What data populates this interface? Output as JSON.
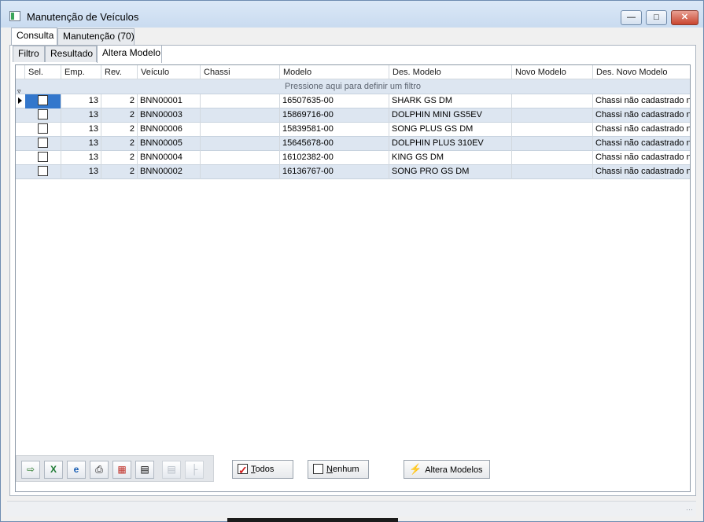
{
  "window": {
    "title": "Manutenção de Veículos"
  },
  "top_tabs": [
    {
      "label": "Consulta"
    },
    {
      "label": "Manutenção (70)"
    }
  ],
  "sub_tabs": [
    {
      "label": "Filtro"
    },
    {
      "label": "Resultado"
    },
    {
      "label": "Altera Modelo"
    }
  ],
  "grid": {
    "columns": [
      "Sel.",
      "Emp.",
      "Rev.",
      "Veículo",
      "Chassi",
      "Modelo",
      "Des. Modelo",
      "Novo Modelo",
      "Des. Novo Modelo"
    ],
    "filter_prompt": "Pressione aqui para definir um filtro",
    "rows": [
      {
        "emp": "13",
        "rev": "2",
        "veiculo": "BNN00001",
        "chassi": "",
        "modelo": "16507635-00",
        "des_modelo": "SHARK GS DM",
        "novo_modelo": "",
        "des_novo_modelo": "Chassi não cadastrado na"
      },
      {
        "emp": "13",
        "rev": "2",
        "veiculo": "BNN00003",
        "chassi": "",
        "modelo": "15869716-00",
        "des_modelo": "DOLPHIN MINI GS5EV",
        "novo_modelo": "",
        "des_novo_modelo": "Chassi não cadastrado na"
      },
      {
        "emp": "13",
        "rev": "2",
        "veiculo": "BNN00006",
        "chassi": "",
        "modelo": "15839581-00",
        "des_modelo": "SONG PLUS GS DM",
        "novo_modelo": "",
        "des_novo_modelo": "Chassi não cadastrado na"
      },
      {
        "emp": "13",
        "rev": "2",
        "veiculo": "BNN00005",
        "chassi": "",
        "modelo": "15645678-00",
        "des_modelo": "DOLPHIN PLUS 310EV",
        "novo_modelo": "",
        "des_novo_modelo": "Chassi não cadastrado na"
      },
      {
        "emp": "13",
        "rev": "2",
        "veiculo": "BNN00004",
        "chassi": "",
        "modelo": "16102382-00",
        "des_modelo": "KING GS DM",
        "novo_modelo": "",
        "des_novo_modelo": "Chassi não cadastrado na"
      },
      {
        "emp": "13",
        "rev": "2",
        "veiculo": "BNN00002",
        "chassi": "",
        "modelo": "16136767-00",
        "des_modelo": "SONG PRO GS DM",
        "novo_modelo": "",
        "des_novo_modelo": "Chassi não cadastrado na"
      }
    ]
  },
  "toolbar": {
    "icons": [
      "export-icon",
      "excel-icon",
      "browser-icon",
      "print-icon",
      "pdf-icon",
      "document-icon",
      "copy-icon",
      "tree-icon"
    ]
  },
  "actions": {
    "todos_prefix": "T",
    "todos_rest": "odos",
    "nenhum_prefix": "N",
    "nenhum_rest": "enhum",
    "altera_label": "Altera Modelos"
  },
  "colors": {
    "row_alt": "#dde6f1",
    "selection": "#3377cc",
    "accent": "#d21b1b"
  }
}
